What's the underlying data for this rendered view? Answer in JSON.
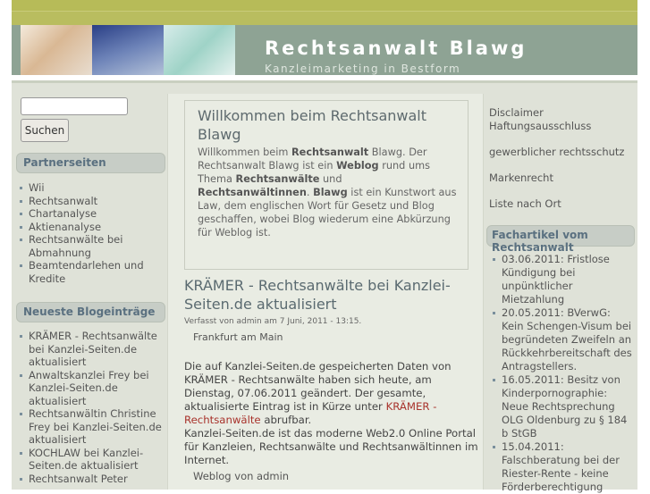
{
  "site": {
    "title": "Rechtsanwalt Blawg",
    "slogan": "Kanzleimarketing in Bestform"
  },
  "search": {
    "value": "",
    "button_label": "Suchen"
  },
  "partner": {
    "title": "Partnerseiten",
    "items": [
      "Wii",
      "Rechtsanwalt",
      "Chartanalyse",
      "Aktienanalyse",
      "Rechtsanwälte bei Abmahnung",
      "Beamtendarlehen und Kredite"
    ]
  },
  "recent": {
    "title": "Neueste Blogeinträge",
    "items": [
      "KRÄMER - Rechtsanwälte bei Kanzlei-Seiten.de aktualisiert",
      "Anwaltskanzlei Frey bei Kanzlei-Seiten.de aktualisiert",
      "Rechtsanwältin Christine Frey bei Kanzlei-Seiten.de aktualisiert",
      "KOCHLAW bei Kanzlei-Seiten.de aktualisiert",
      "Rechtsanwalt Peter"
    ]
  },
  "welcome": {
    "title": "Willkommen beim Rechtsanwalt Blawg",
    "p1": "Willkommen beim ",
    "b1": "Rechtsanwalt",
    "p2": " Blawg. Der Rechtsanwalt Blawg ist ein ",
    "b2": "Weblog",
    "p3": " rund ums Thema ",
    "b3": "Rechtsanwälte",
    "p4": " und ",
    "b4": "Rechtsanwältinnen",
    "p5": ". ",
    "b5": "Blawg",
    "p6": " ist ein Kunstwort aus Law, dem englischen Wort für Gesetz und Blog geschaffen, wobei Blog wiederum eine Abkürzung für Weblog ist."
  },
  "node": {
    "title": "KRÄMER - Rechtsanwälte bei Kanzlei-Seiten.de aktualisiert",
    "submitted": "Verfasst von admin am 7 Juni, 2011 - 13:15.",
    "location": "Frankfurt am Main",
    "body1": "Die auf Kanzlei-Seiten.de gespeicherten Daten von KRÄMER - Rechtsanwälte haben sich heute, am Dienstag, 07.06.2011 geändert. Der gesamte, aktualisierte Eintrag ist in Kürze unter ",
    "link": "KRÄMER - Rechtsanwälte",
    "body2": " abrufbar.",
    "body3": "Kanzlei-Seiten.de ist das moderne Web2.0 Online Portal für Kanzleien, Rechtsanwälte und Rechtsanwältinnen im Internet.",
    "blog_link": "Weblog von admin"
  },
  "right": {
    "links": [
      "Disclaimer",
      "Haftungsausschluss",
      "gewerblicher rechtsschutz",
      "Markenrecht",
      "Liste nach Ort"
    ],
    "articles_title_1": "Fachartikel vom",
    "articles_title_2": "Rechtsanwalt",
    "articles": [
      "03.06.2011: Fristlose Kündigung bei unpünktlicher Mietzahlung",
      "20.05.2011: BVerwG: Kein Schengen-Visum bei begründeten Zweifeln an Rückkehrbereitschaft des Antragstellers.",
      "16.05.2011: Besitz von Kinderpornographie: Neue Rechtsprechung OLG Oldenburg zu § 184 b StGB",
      "15.04.2011: Falschberatung bei der Riester-Rente - keine Förderberechtigung"
    ]
  },
  "colors": {
    "header_bg": "#8ea394",
    "topbar": "#b7bb58",
    "link_red": "#a8322b",
    "block_title": "#5a7080"
  }
}
